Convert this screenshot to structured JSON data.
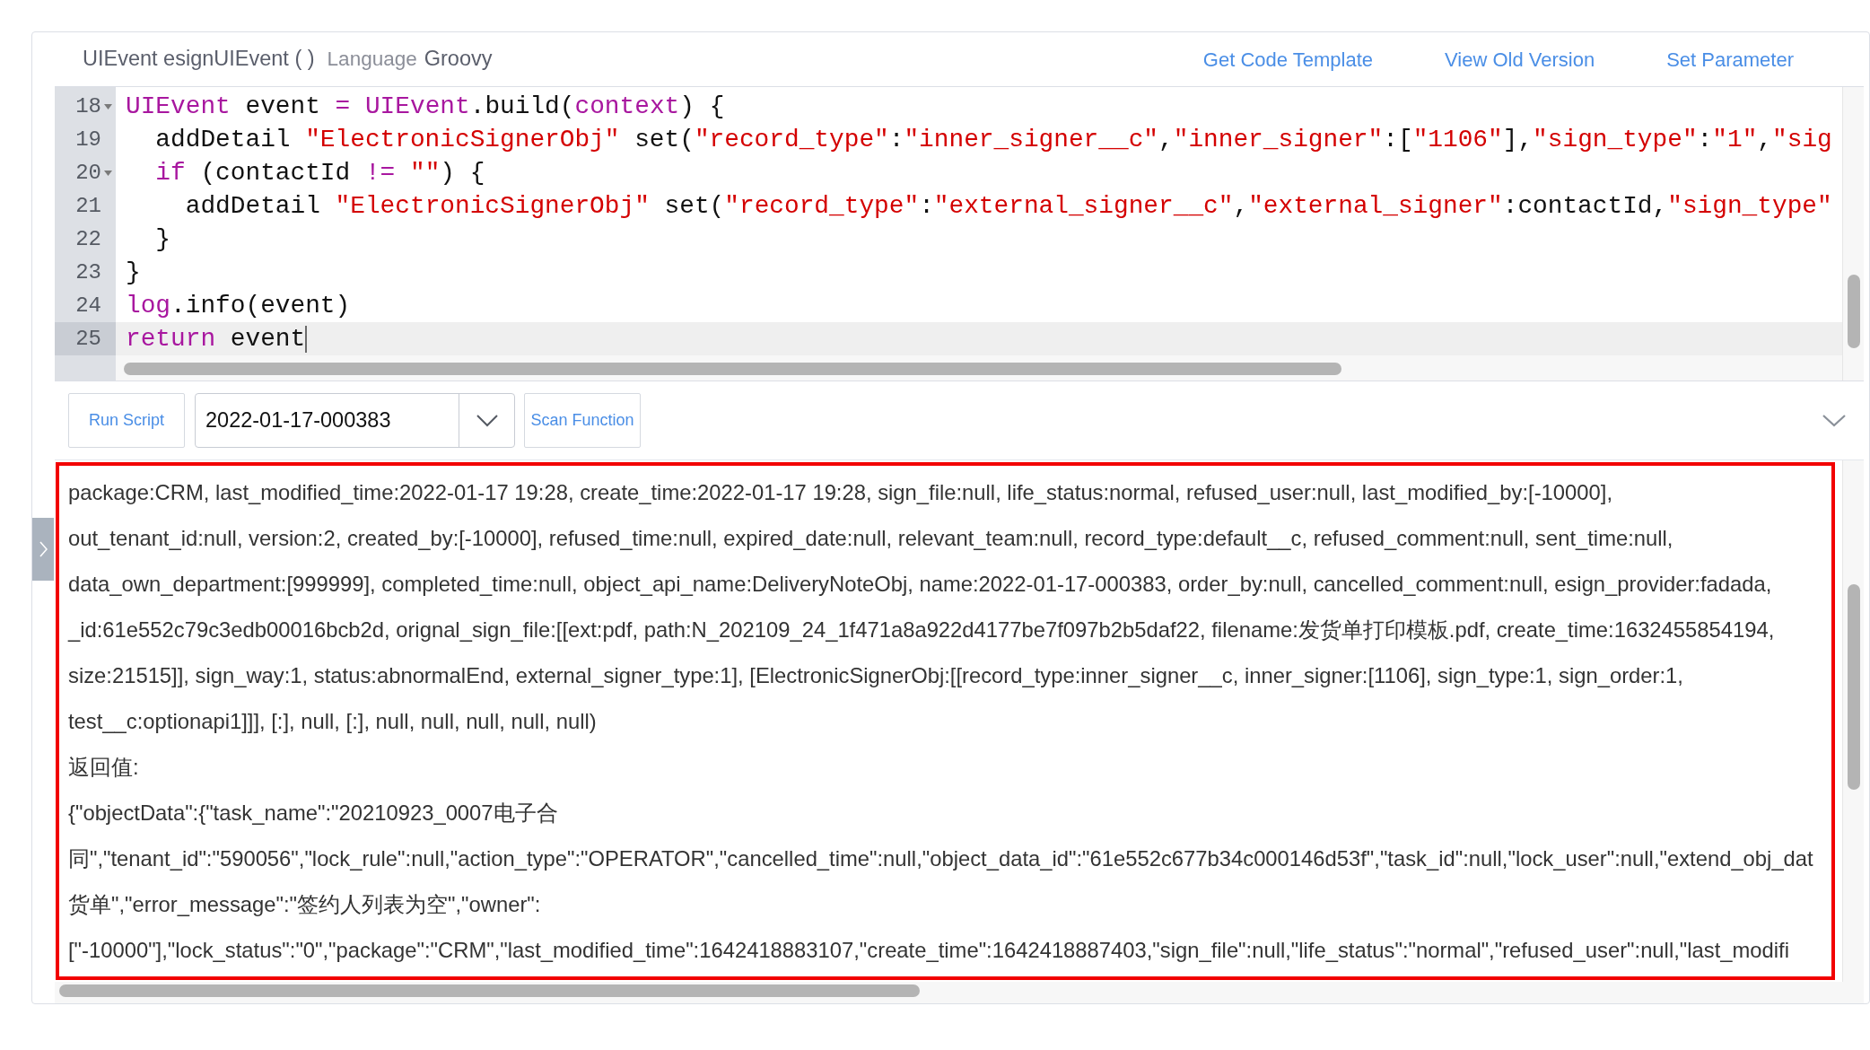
{
  "header": {
    "title": "UIEvent esignUIEvent ( )",
    "language_label": "Language",
    "language": "Groovy",
    "links": [
      "Get Code Template",
      "View Old Version",
      "Set Parameter"
    ]
  },
  "editor": {
    "lines": [
      {
        "number": "18",
        "foldable": true,
        "active": false,
        "tokens": [
          {
            "kind": "keyword",
            "text": "UIEvent"
          },
          {
            "kind": "plain",
            "text": " event "
          },
          {
            "kind": "keyword",
            "text": "= UIEvent"
          },
          {
            "kind": "plain",
            "text": ".build("
          },
          {
            "kind": "keyword",
            "text": "context"
          },
          {
            "kind": "plain",
            "text": ") {"
          }
        ]
      },
      {
        "number": "19",
        "foldable": false,
        "active": false,
        "tokens": [
          {
            "kind": "plain",
            "text": "  addDetail "
          },
          {
            "kind": "string",
            "text": "\"ElectronicSignerObj\""
          },
          {
            "kind": "plain",
            "text": " set("
          },
          {
            "kind": "string",
            "text": "\"record_type\""
          },
          {
            "kind": "plain",
            "text": ":"
          },
          {
            "kind": "string",
            "text": "\"inner_signer__c\""
          },
          {
            "kind": "plain",
            "text": ","
          },
          {
            "kind": "string",
            "text": "\"inner_signer\""
          },
          {
            "kind": "plain",
            "text": ":["
          },
          {
            "kind": "string",
            "text": "\"1106\""
          },
          {
            "kind": "plain",
            "text": "],"
          },
          {
            "kind": "string",
            "text": "\"sign_type\""
          },
          {
            "kind": "plain",
            "text": ":"
          },
          {
            "kind": "string",
            "text": "\"1\""
          },
          {
            "kind": "plain",
            "text": ","
          },
          {
            "kind": "string",
            "text": "\"sig"
          }
        ]
      },
      {
        "number": "20",
        "foldable": true,
        "active": false,
        "tokens": [
          {
            "kind": "keyword",
            "text": "  if"
          },
          {
            "kind": "plain",
            "text": " (contactId "
          },
          {
            "kind": "keyword",
            "text": "!="
          },
          {
            "kind": "string",
            "text": " \"\""
          },
          {
            "kind": "plain",
            "text": ") {"
          }
        ]
      },
      {
        "number": "21",
        "foldable": false,
        "active": false,
        "tokens": [
          {
            "kind": "plain",
            "text": "    addDetail "
          },
          {
            "kind": "string",
            "text": "\"ElectronicSignerObj\""
          },
          {
            "kind": "plain",
            "text": " set("
          },
          {
            "kind": "string",
            "text": "\"record_type\""
          },
          {
            "kind": "plain",
            "text": ":"
          },
          {
            "kind": "string",
            "text": "\"external_signer__c\""
          },
          {
            "kind": "plain",
            "text": ","
          },
          {
            "kind": "string",
            "text": "\"external_signer\""
          },
          {
            "kind": "plain",
            "text": ":contactId,"
          },
          {
            "kind": "string",
            "text": "\"sign_type\""
          }
        ]
      },
      {
        "number": "22",
        "foldable": false,
        "active": false,
        "tokens": [
          {
            "kind": "plain",
            "text": "  }"
          }
        ]
      },
      {
        "number": "23",
        "foldable": false,
        "active": false,
        "tokens": [
          {
            "kind": "plain",
            "text": "}"
          }
        ]
      },
      {
        "number": "24",
        "foldable": false,
        "active": false,
        "tokens": [
          {
            "kind": "keyword",
            "text": "log"
          },
          {
            "kind": "plain",
            "text": ".info(event)"
          }
        ]
      },
      {
        "number": "25",
        "foldable": false,
        "active": true,
        "tokens": [
          {
            "kind": "keyword",
            "text": "return"
          },
          {
            "kind": "plain",
            "text": " event"
          }
        ]
      }
    ]
  },
  "toolbar": {
    "run_button": "Run Script",
    "record_select": "2022-01-17-000383",
    "scan_button": "Scan Function"
  },
  "output": {
    "lines": [
      "package:CRM, last_modified_time:2022-01-17 19:28, create_time:2022-01-17 19:28, sign_file:null, life_status:normal, refused_user:null, last_modified_by:[-10000],",
      "out_tenant_id:null, version:2, created_by:[-10000], refused_time:null, expired_date:null, relevant_team:null, record_type:default__c, refused_comment:null, sent_time:null,",
      "data_own_department:[999999], completed_time:null, object_api_name:DeliveryNoteObj, name:2022-01-17-000383, order_by:null, cancelled_comment:null, esign_provider:fadada,",
      "_id:61e552c79c3edb00016bcb2d, orignal_sign_file:[[ext:pdf, path:N_202109_24_1f471a8a922d4177be7f097b2b5daf22, filename:发货单打印模板.pdf, create_time:1632455854194,",
      "size:21515]], sign_way:1, status:abnormalEnd, external_signer_type:1], [ElectronicSignerObj:[[record_type:inner_signer__c, inner_signer:[1106], sign_type:1, sign_order:1,",
      "test__c:optionapi1]]], [:], null, [:], null, null, null, null, null)",
      "返回值:",
      "{\"objectData\":{\"task_name\":\"20210923_0007电子合",
      "同\",\"tenant_id\":\"590056\",\"lock_rule\":null,\"action_type\":\"OPERATOR\",\"cancelled_time\":null,\"object_data_id\":\"61e552c677b34c000146d53f\",\"task_id\":null,\"lock_user\":null,\"extend_obj_dat",
      "货单\",\"error_message\":\"签约人列表为空\",\"owner\":",
      "[\"-10000\"],\"lock_status\":\"0\",\"package\":\"CRM\",\"last_modified_time\":1642418883107,\"create_time\":1642418887403,\"sign_file\":null,\"life_status\":\"normal\",\"refused_user\":null,\"last_modifi"
    ]
  }
}
